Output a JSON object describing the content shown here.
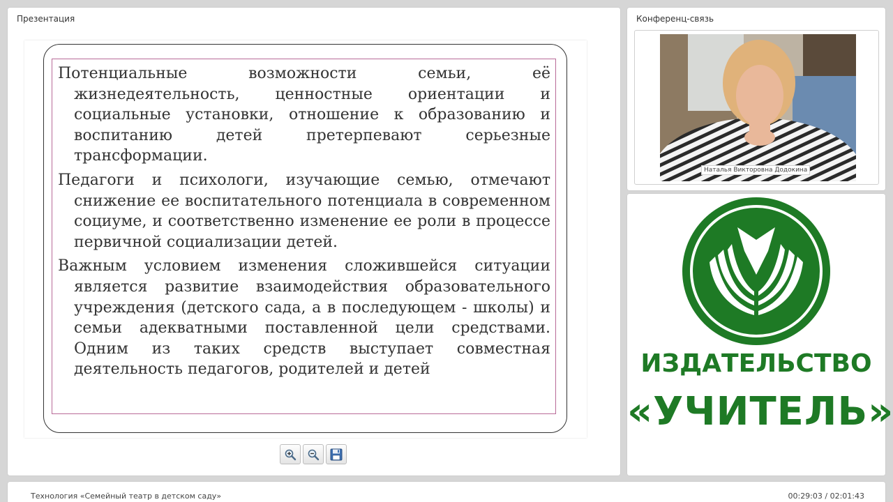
{
  "presentation": {
    "title": "Презентация",
    "slide": {
      "paragraphs": [
        "Потенциальные возможности семьи, её жизнедеятельность, ценностные ориентации и социальные установки, отношение к образованию и воспитанию детей претерпевают серьезные трансформации.",
        "Педагоги и психологи, изучающие семью, отмечают снижение ее воспитательного потенциала в современном социуме, и соответственно изменение ее роли в процессе первичной социализации детей.",
        "Важным условием изменения сложившейся ситуации является развитие взаимодействия образовательного учреждения (детского сада, а в последующем - школы) и семьи адекватными поставленной цели средствами. Одним из таких средств выступает совместная деятельность педагогов, родителей и детей"
      ]
    },
    "toolbar": {
      "zoom_in_icon": "zoom-in-icon",
      "zoom_out_icon": "zoom-out-icon",
      "save_icon": "floppy-disk-icon"
    }
  },
  "conference": {
    "title": "Конференц-связь",
    "speaker_name": "Наталья Викторовна Додокина"
  },
  "publisher": {
    "line1": "ИЗДАТЕЛЬСТВО",
    "line2": "«УЧИТЕЛЬ»",
    "brand_color": "#1e7a25"
  },
  "footer": {
    "course_title": "Технология «Семейный театр в детском саду»",
    "timecode": "00:29:03 / 02:01:43"
  }
}
